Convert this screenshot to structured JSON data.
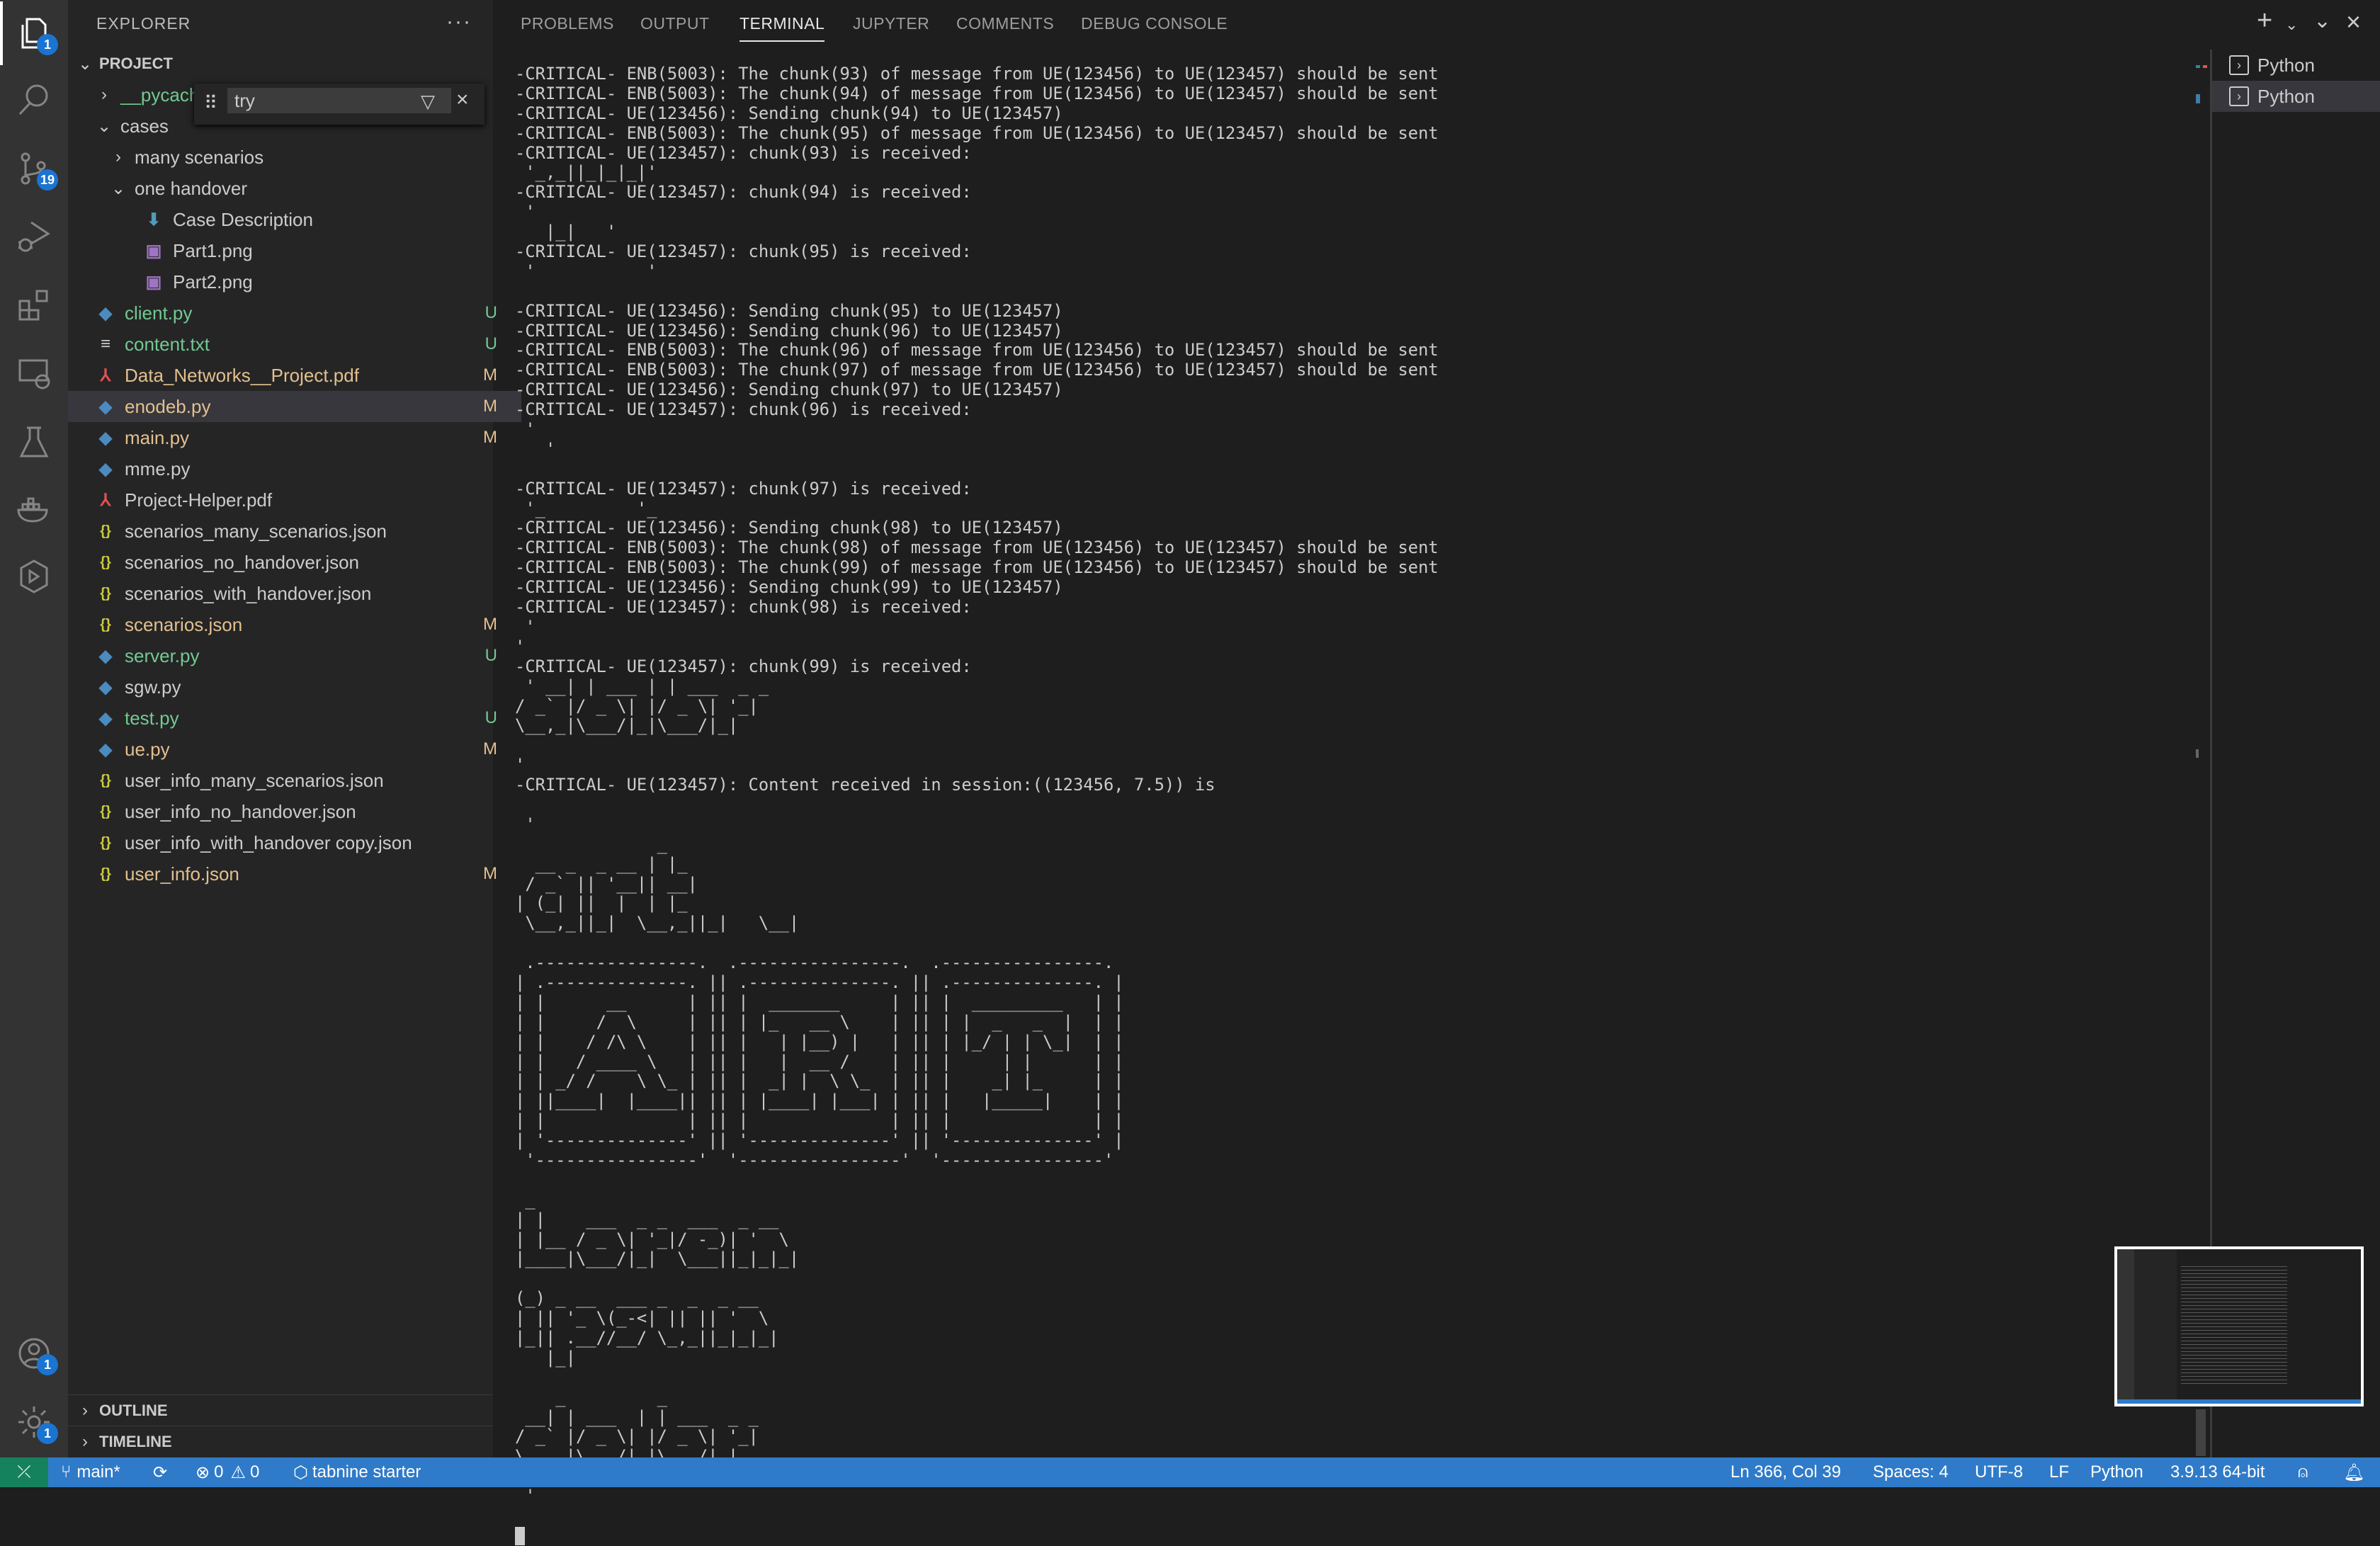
{
  "activity_bar": {
    "items": [
      {
        "name": "explorer",
        "badge": "1"
      },
      {
        "name": "search"
      },
      {
        "name": "source-control",
        "badge": "19"
      },
      {
        "name": "run-debug"
      },
      {
        "name": "extensions"
      },
      {
        "name": "remote-explorer"
      },
      {
        "name": "testing"
      },
      {
        "name": "docker"
      },
      {
        "name": "live-share"
      }
    ],
    "accounts_badge": "1",
    "settings_badge": "1"
  },
  "sidebar": {
    "title": "EXPLORER",
    "more": "···",
    "project_label": "PROJECT",
    "outline_label": "OUTLINE",
    "timeline_label": "TIMELINE",
    "find": {
      "value": "try"
    },
    "tree": [
      {
        "label": "__pycach",
        "type": "folder",
        "expanded": false,
        "depth": 0,
        "status": "",
        "color": "U"
      },
      {
        "label": "cases",
        "type": "folder",
        "expanded": true,
        "depth": 0,
        "status": ""
      },
      {
        "label": "many scenarios",
        "type": "folder",
        "expanded": false,
        "depth": 1,
        "status": ""
      },
      {
        "label": "one handover",
        "type": "folder",
        "expanded": true,
        "depth": 1,
        "status": ""
      },
      {
        "label": "Case Description",
        "type": "download",
        "depth": 2,
        "status": ""
      },
      {
        "label": "Part1.png",
        "type": "image",
        "depth": 2,
        "status": ""
      },
      {
        "label": "Part2.png",
        "type": "image",
        "depth": 2,
        "status": ""
      },
      {
        "label": "client.py",
        "type": "python",
        "depth": 0,
        "status": "U"
      },
      {
        "label": "content.txt",
        "type": "text",
        "depth": 0,
        "status": "U"
      },
      {
        "label": "Data_Networks__Project.pdf",
        "type": "pdf",
        "depth": 0,
        "status": "M"
      },
      {
        "label": "enodeb.py",
        "type": "python",
        "depth": 0,
        "status": "M",
        "selected": true
      },
      {
        "label": "main.py",
        "type": "python",
        "depth": 0,
        "status": "M"
      },
      {
        "label": "mme.py",
        "type": "python",
        "depth": 0,
        "status": ""
      },
      {
        "label": "Project-Helper.pdf",
        "type": "pdf",
        "depth": 0,
        "status": ""
      },
      {
        "label": "scenarios_many_scenarios.json",
        "type": "json",
        "depth": 0,
        "status": ""
      },
      {
        "label": "scenarios_no_handover.json",
        "type": "json",
        "depth": 0,
        "status": ""
      },
      {
        "label": "scenarios_with_handover.json",
        "type": "json",
        "depth": 0,
        "status": ""
      },
      {
        "label": "scenarios.json",
        "type": "json",
        "depth": 0,
        "status": "M"
      },
      {
        "label": "server.py",
        "type": "python",
        "depth": 0,
        "status": "U"
      },
      {
        "label": "sgw.py",
        "type": "python",
        "depth": 0,
        "status": ""
      },
      {
        "label": "test.py",
        "type": "python",
        "depth": 0,
        "status": "U"
      },
      {
        "label": "ue.py",
        "type": "python",
        "depth": 0,
        "status": "M"
      },
      {
        "label": "user_info_many_scenarios.json",
        "type": "json",
        "depth": 0,
        "status": ""
      },
      {
        "label": "user_info_no_handover.json",
        "type": "json",
        "depth": 0,
        "status": ""
      },
      {
        "label": "user_info_with_handover copy.json",
        "type": "json",
        "depth": 0,
        "status": ""
      },
      {
        "label": "user_info.json",
        "type": "json",
        "depth": 0,
        "status": "M"
      }
    ]
  },
  "panel": {
    "tabs": [
      "PROBLEMS",
      "OUTPUT",
      "TERMINAL",
      "JUPYTER",
      "COMMENTS",
      "DEBUG CONSOLE"
    ],
    "active_tab": "TERMINAL",
    "terminals": [
      "Python",
      "Python"
    ],
    "terminal_lines": [
      "-CRITICAL- ENB(5003): The chunk(93) of message from UE(123456) to UE(123457) should be sent",
      "-CRITICAL- ENB(5003): The chunk(94) of message from UE(123456) to UE(123457) should be sent",
      "-CRITICAL- UE(123456): Sending chunk(94) to UE(123457)",
      "-CRITICAL- ENB(5003): The chunk(95) of message from UE(123456) to UE(123457) should be sent",
      "-CRITICAL- UE(123457): chunk(93) is received:",
      " '_,_||_|_|_|'",
      "-CRITICAL- UE(123457): chunk(94) is received:",
      " '",
      "   |_|   '",
      "-CRITICAL- UE(123457): chunk(95) is received:",
      " '           '",
      "",
      "-CRITICAL- UE(123456): Sending chunk(95) to UE(123457)",
      "-CRITICAL- UE(123456): Sending chunk(96) to UE(123457)",
      "-CRITICAL- ENB(5003): The chunk(96) of message from UE(123456) to UE(123457) should be sent",
      "-CRITICAL- ENB(5003): The chunk(97) of message from UE(123456) to UE(123457) should be sent",
      "-CRITICAL- UE(123456): Sending chunk(97) to UE(123457)",
      "-CRITICAL- UE(123457): chunk(96) is received:",
      " '",
      "   '",
      "",
      "-CRITICAL- UE(123457): chunk(97) is received:",
      " '_         '_",
      "-CRITICAL- UE(123456): Sending chunk(98) to UE(123457)",
      "-CRITICAL- ENB(5003): The chunk(98) of message from UE(123456) to UE(123457) should be sent",
      "-CRITICAL- ENB(5003): The chunk(99) of message from UE(123456) to UE(123457) should be sent",
      "-CRITICAL- UE(123456): Sending chunk(99) to UE(123457)",
      "-CRITICAL- UE(123457): chunk(98) is received:",
      " '",
      "'",
      "-CRITICAL- UE(123457): chunk(99) is received:",
      " ' __| | ___ | | ___  _ _",
      "/ _` |/ _ \\| |/ _ \\| '_|",
      "\\__,_|\\___/|_|\\___/|_|",
      "",
      "'",
      "-CRITICAL- UE(123457): Content received in session:((123456, 7.5)) is",
      "",
      " '",
      "              _",
      "  __ _  _ __ | |_",
      " / _` || '__|| __|",
      "| (_| ||  |  | |_",
      " \\__,_||_|  \\__,_||_|   \\__|",
      "",
      " .----------------.  .----------------.  .----------------. ",
      "| .--------------. || .--------------. || .--------------. |",
      "| |      __      | || |  _______     | || |  _________   | |",
      "| |     /  \\     | || | |_   __ \\    | || | |  _   _  |  | |",
      "| |    / /\\ \\    | || |   | |__) |   | || | |_/ | | \\_|  | |",
      "| |   / ____ \\   | || |   |  __ /    | || |     | |      | |",
      "| | _/ /    \\ \\_ | || |  _| |  \\ \\_  | || |    _| |_     | |",
      "| ||____|  |____|| || | |____| |___| | || |   |_____|    | |",
      "| |              | || |              | || |              | |",
      "| '--------------' || '--------------' || '--------------' |",
      " '----------------'  '----------------'  '----------------' ",
      "",
      " _",
      "| |    ___  _ _  ___  _ __",
      "| |__ / _ \\| '_|/ -_)| '  \\",
      "|____|\\___/|_|  \\___||_|_|_|",
      "",
      "(_) _ __  ___ _  _  _ __",
      "| || '_ \\(_-<| || || '  \\",
      "|_|| .__//__/ \\_,_||_|_|_|",
      "   |_|",
      "",
      "    _         _",
      " __| | ___  | | ___  _ _",
      "/ _` |/ _ \\| |/ _ \\| '_|",
      "\\__,_|\\___/|_|\\___/|_|",
      "",
      " '",
      ""
    ]
  },
  "statusbar": {
    "branch": "main*",
    "errors": "0",
    "warnings": "0",
    "tabnine": "tabnine starter",
    "position": "Ln 366, Col 39",
    "indent": "Spaces: 4",
    "encoding": "UTF-8",
    "eol": "LF",
    "language": "Python",
    "interpreter": "3.9.13 64-bit"
  },
  "colors": {
    "accent": "#2f7bc9",
    "untracked": "#73c991",
    "modified": "#e2c08d"
  }
}
